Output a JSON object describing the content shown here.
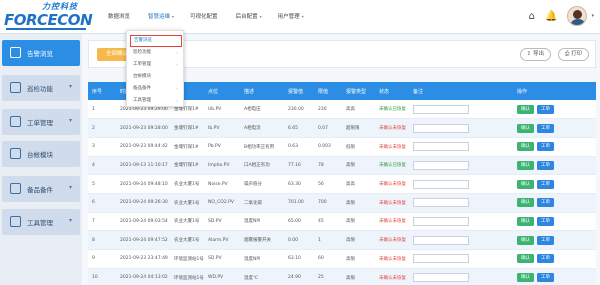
{
  "brand": {
    "cn": "力控科技",
    "en": "FORCECON"
  },
  "nav": [
    {
      "label": "数据浏览",
      "caret": ""
    },
    {
      "label": "智慧运维",
      "caret": "▾"
    },
    {
      "label": "可视化配置",
      "caret": ""
    },
    {
      "label": "后台配置",
      "caret": "▾"
    },
    {
      "label": "用户管理",
      "caret": "▾"
    }
  ],
  "sidebar": [
    {
      "label": "告警浏览",
      "chev": ""
    },
    {
      "label": "巡检功能",
      "chev": "▾"
    },
    {
      "label": "工单管理",
      "chev": "▾"
    },
    {
      "label": "台帐模块",
      "chev": ""
    },
    {
      "label": "备品备件",
      "chev": "▾"
    },
    {
      "label": "工具管理",
      "chev": "▾"
    }
  ],
  "dropdown": [
    {
      "label": "告警浏览",
      "chev": ""
    },
    {
      "label": "巡检功能",
      "chev": "›"
    },
    {
      "label": "工单管理",
      "chev": "›"
    },
    {
      "label": "台帐模块",
      "chev": ""
    },
    {
      "label": "备品备件",
      "chev": "›"
    },
    {
      "label": "工具管理",
      "chev": "›"
    }
  ],
  "toolbar": {
    "confirm": "全部确认",
    "export": "导出",
    "print": "打印"
  },
  "table": {
    "headers": [
      "序号",
      "时间",
      "厂站",
      "点位",
      "描述",
      "报警值",
      "限值",
      "报警类型",
      "状态",
      "备注",
      "操作"
    ],
    "rows": [
      [
        "1",
        "2021-09-23 09:29:00",
        "金堰钉煤1#",
        "Ub.PV",
        "A相电压",
        "230.00",
        "230",
        "高高",
        "未确认已恢复"
      ],
      [
        "2",
        "2021-09-23 09:28:00",
        "金堰钉煤1#",
        "Ib.PV",
        "A相电流",
        "6.65",
        "0.07",
        "超限限",
        "未确认未恢复"
      ],
      [
        "3",
        "2021-09-23 09:44:42",
        "金堰钉煤1#",
        "Pb.PV",
        "B相功率正有用",
        "0.63",
        "0.003",
        "低限",
        "未确认未恢复"
      ],
      [
        "4",
        "2021-09-13 11:10:17",
        "金堰钉煤1#",
        "Impha.PV",
        "口A相正有功",
        "77.16",
        "78",
        "高限",
        "未确认已恢复"
      ],
      [
        "5",
        "2021-09-24 09:48:10",
        "农业大厦1号",
        "Noise.PV",
        "噪声值分",
        "63.30",
        "56",
        "高高",
        "未确认未恢复"
      ],
      [
        "6",
        "2021-09-24 09:26:30",
        "农业大厦1号",
        "NO_CO2.PV",
        "二氧化碳",
        "701.00",
        "700",
        "高限",
        "未确认未恢复"
      ],
      [
        "7",
        "2021-09-24 09:03:54",
        "农业大厦1号",
        "SD.PV",
        "温度NPI",
        "65.00",
        "45",
        "高限",
        "未确认未恢复"
      ],
      [
        "8",
        "2021-09-24 09:47:52",
        "农业大厦1号",
        "Alarm.PV",
        "烟雾报警开关",
        "0.00",
        "1",
        "高限",
        "未确认未恢复"
      ],
      [
        "9",
        "2021-09-23 23:47:49",
        "环境监测站1号",
        "SD.PV",
        "温度NPI",
        "63.10",
        "60",
        "高限",
        "未确认未恢复"
      ],
      [
        "10",
        "2021-09-24 04:13:02",
        "环境监测站1号",
        "WD.PV",
        "温度℃",
        "24.90",
        "25",
        "高限",
        "未确认未恢复"
      ]
    ],
    "btn_confirm": "确认",
    "btn_order": "工单"
  },
  "icons": [
    "home-icon",
    "bell-icon",
    "avatar"
  ],
  "colors": {
    "primary": "#2b8de3",
    "header": "#2b8de3",
    "warning": "#f7b84b",
    "ok": "#2e9a3a",
    "bad": "#e0443a"
  }
}
